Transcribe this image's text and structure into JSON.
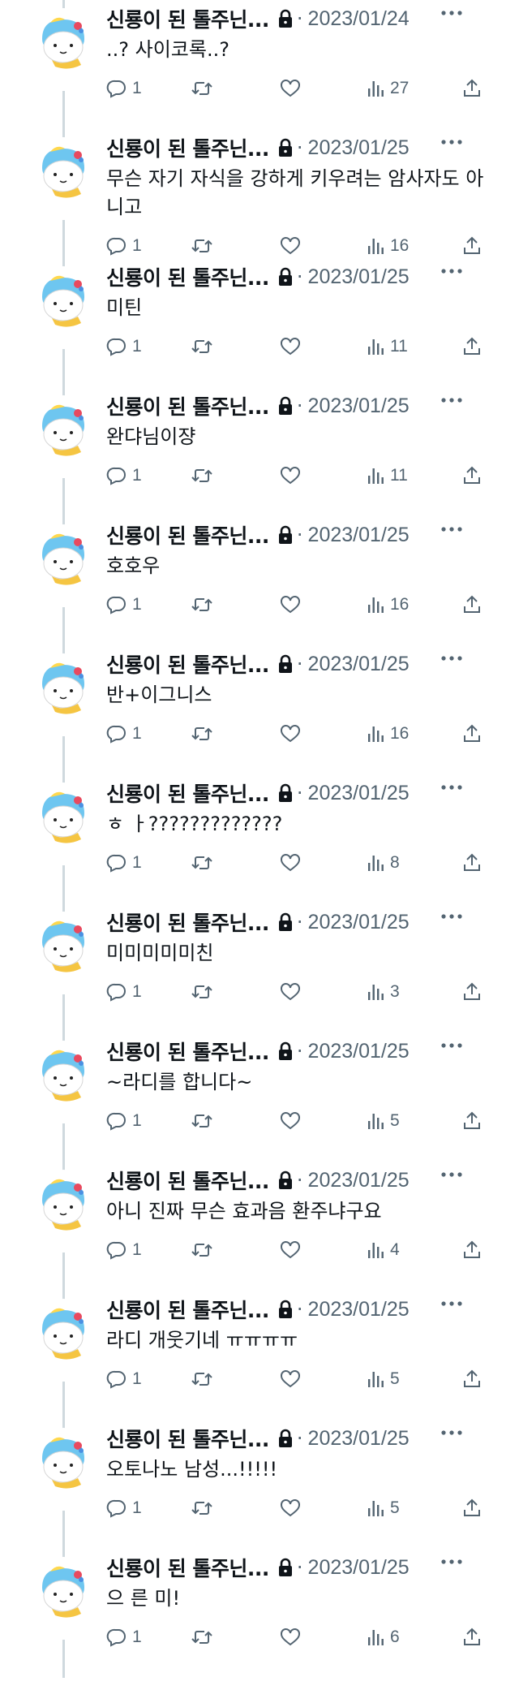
{
  "author": {
    "name": "신룡이 된 톨주닌...",
    "protected_icon": "lock-icon"
  },
  "separator": "·",
  "icons": {
    "reply": "reply-icon",
    "retweet": "retweet-icon",
    "like": "heart-icon",
    "views": "analytics-icon",
    "share": "share-icon",
    "more": "more-icon"
  },
  "colors": {
    "text": "#0f1419",
    "secondary": "#536471",
    "thread_line": "#cfd9de"
  },
  "tweets": [
    {
      "date": "2023/01/24",
      "text": "..? 사이코록..?",
      "replies": "1",
      "views": "27"
    },
    {
      "date": "2023/01/25",
      "text": "무슨 자기 자식을 강하게 키우려는 암사자도 아니고",
      "replies": "1",
      "views": "16"
    },
    {
      "date": "2023/01/25",
      "text": "미틴",
      "replies": "1",
      "views": "11"
    },
    {
      "date": "2023/01/25",
      "text": "완댜님이쟝",
      "replies": "1",
      "views": "11"
    },
    {
      "date": "2023/01/25",
      "text": "호호우",
      "replies": "1",
      "views": "16"
    },
    {
      "date": "2023/01/25",
      "text": "반+이그니스",
      "replies": "1",
      "views": "16"
    },
    {
      "date": "2023/01/25",
      "text": "ㅎ ㅏ?????????????",
      "replies": "1",
      "views": "8"
    },
    {
      "date": "2023/01/25",
      "text": "미미미미미친",
      "replies": "1",
      "views": "3"
    },
    {
      "date": "2023/01/25",
      "text": "~라디를 합니다~",
      "replies": "1",
      "views": "5"
    },
    {
      "date": "2023/01/25",
      "text": "아니 진짜 무슨 효과음 환주냐구요",
      "replies": "1",
      "views": "4"
    },
    {
      "date": "2023/01/25",
      "text": "라디 개웃기네 ㅠㅠㅠㅠ",
      "replies": "1",
      "views": "5"
    },
    {
      "date": "2023/01/25",
      "text": "오토나노 남성...!!!!!",
      "replies": "1",
      "views": "5"
    },
    {
      "date": "2023/01/25",
      "text": "으 른 미!",
      "replies": "1",
      "views": "6"
    }
  ]
}
